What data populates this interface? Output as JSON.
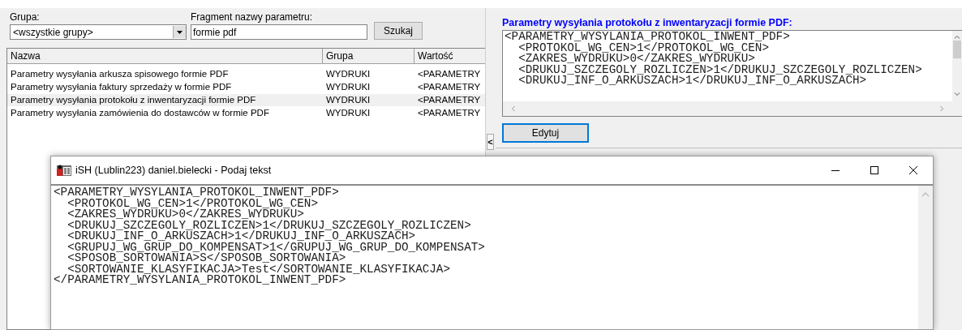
{
  "filter": {
    "group_label": "Grupa:",
    "group_value": "<wszystkie grupy>",
    "fragment_label": "Fragment nazwy parametru:",
    "fragment_value": "formie pdf",
    "search_button": "Szukaj"
  },
  "table": {
    "columns": [
      "Nazwa",
      "Grupa",
      "Wartość"
    ],
    "rows": [
      {
        "cells": [
          "Parametry wysyłania arkusza spisowego formie PDF",
          "WYDRUKI",
          "<PARAMETRY"
        ],
        "selected": false
      },
      {
        "cells": [
          "Parametry wysyłania faktury sprzedaży w formie PDF",
          "WYDRUKI",
          "<PARAMETRY"
        ],
        "selected": false
      },
      {
        "cells": [
          "Parametry wysyłania protokołu z inwentaryzacji formie PDF",
          "WYDRUKI",
          "<PARAMETRY"
        ],
        "selected": true
      },
      {
        "cells": [
          "Parametry wysyłania zamówienia do dostawców w formie PDF",
          "WYDRUKI",
          "<PARAMETRY"
        ],
        "selected": false
      }
    ]
  },
  "splitter": {
    "collapse_glyph": "<"
  },
  "detail": {
    "title": "Parametry wysyłania protokołu z inwentaryzacji formie PDF:",
    "lines": [
      "<PARAMETRY_WYSYLANIA_PROTOKOL_INWENT_PDF>",
      "  <PROTOKOL_WG_CEN>1</PROTOKOL_WG_CEN>",
      "  <ZAKRES_WYDRUKU>0</ZAKRES_WYDRUKU>",
      "  <DRUKUJ_SZCZEGOLY_ROZLICZEN>1</DRUKUJ_SZCZEGOLY_ROZLICZEN>",
      "  <DRUKUJ_INF_O_ARKUSZACH>1</DRUKUJ_INF_O_ARKUSZACH>"
    ],
    "edit_button": {
      "label": "Edytuj",
      "focused": true
    }
  },
  "dialog": {
    "title": "iSH (Lublin223) daniel.bielecki - Podaj tekst",
    "lines": [
      "<PARAMETRY_WYSYLANIA_PROTOKOL_INWENT_PDF>",
      "  <PROTOKOL_WG_CEN>1</PROTOKOL_WG_CEN>",
      "  <ZAKRES_WYDRUKU>0</ZAKRES_WYDRUKU>",
      "  <DRUKUJ_SZCZEGOLY_ROZLICZEN>1</DRUKUJ_SZCZEGOLY_ROZLICZEN>",
      "  <DRUKUJ_INF_O_ARKUSZACH>1</DRUKUJ_INF_O_ARKUSZACH>",
      "  <GRUPUJ_WG_GRUP_DO_KOMPENSAT>1</GRUPUJ_WG_GRUP_DO_KOMPENSAT>",
      "  <SPOSOB_SORTOWANIA>S</SPOSOB_SORTOWANIA>",
      "  <SORTOWANIE_KLASYFIKACJA>Test</SORTOWANIE_KLASYFIKACJA>",
      "</PARAMETRY_WYSYLANIA_PROTOKOL_INWENT_PDF>"
    ]
  }
}
